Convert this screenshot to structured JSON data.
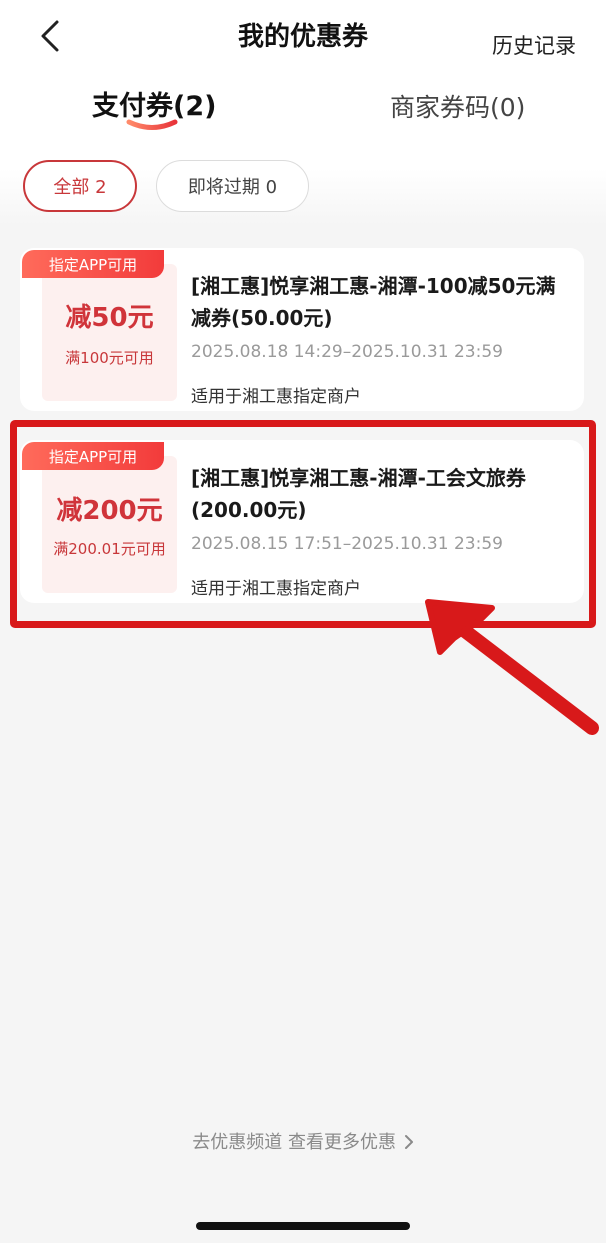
{
  "header": {
    "title": "我的优惠券",
    "history_label": "历史记录"
  },
  "tabs": [
    {
      "label": "支付券(2)",
      "active": true
    },
    {
      "label": "商家券码(0)",
      "active": false
    }
  ],
  "filters": [
    {
      "label": "全部 2",
      "active": true
    },
    {
      "label": "即将过期 0",
      "active": false
    }
  ],
  "coupons": [
    {
      "badge": "指定APP可用",
      "amount": "减50元",
      "condition": "满100元可用",
      "title": "[湘工惠]悦享湘工惠-湘潭-100减50元满减券(50.00元)",
      "time_range": "2025.08.18 14:29–2025.10.31 23:59",
      "scope": "适用于湘工惠指定商户"
    },
    {
      "badge": "指定APP可用",
      "amount": "减200元",
      "condition": "满200.01元可用",
      "title": "[湘工惠]悦享湘工惠-湘潭-工会文旅券(200.00元)",
      "time_range": "2025.08.15 17:51–2025.10.31 23:59",
      "scope": "适用于湘工惠指定商户"
    }
  ],
  "footer": {
    "more_label": "去优惠频道 查看更多优惠"
  },
  "colors": {
    "accent": "#c8373a",
    "annotation": "#d8191a"
  }
}
